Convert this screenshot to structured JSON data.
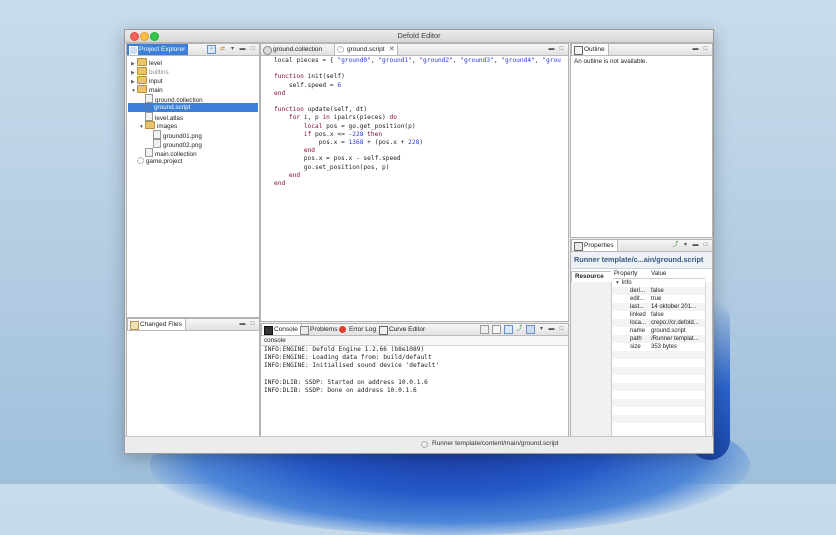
{
  "window": {
    "title": "Defold Editor"
  },
  "project_explorer": {
    "tab_label": "Project Explorer",
    "items": [
      {
        "label": "level",
        "kind": "folder",
        "indent": 0,
        "arrow": "▶"
      },
      {
        "label": "builtins",
        "kind": "folder",
        "indent": 0,
        "arrow": "▶"
      },
      {
        "label": "input",
        "kind": "folder",
        "indent": 0,
        "arrow": "▶"
      },
      {
        "label": "main",
        "kind": "folder",
        "indent": 0,
        "arrow": "▼"
      },
      {
        "label": "ground.collection",
        "kind": "file",
        "indent": 1,
        "arrow": ""
      },
      {
        "label": "ground.script",
        "kind": "script",
        "indent": 1,
        "arrow": "",
        "selected": true
      },
      {
        "label": "level.atlas",
        "kind": "file",
        "indent": 1,
        "arrow": ""
      },
      {
        "label": "images",
        "kind": "folder",
        "indent": 1,
        "arrow": "▼"
      },
      {
        "label": "ground01.png",
        "kind": "file",
        "indent": 2,
        "arrow": ""
      },
      {
        "label": "ground02.png",
        "kind": "file",
        "indent": 2,
        "arrow": ""
      },
      {
        "label": "main.collection",
        "kind": "file",
        "indent": 1,
        "arrow": ""
      },
      {
        "label": "game.project",
        "kind": "script",
        "indent": 0,
        "arrow": ""
      }
    ]
  },
  "changed_files": {
    "tab_label": "Changed Files"
  },
  "editor": {
    "tabs": [
      {
        "label": "ground.collection"
      },
      {
        "label": "ground.script"
      }
    ],
    "code": [
      [
        [
          "t",
          "local pieces = { "
        ],
        [
          "s",
          "\"ground0\""
        ],
        [
          "t",
          ", "
        ],
        [
          "s",
          "\"ground1\""
        ],
        [
          "t",
          ", "
        ],
        [
          "s",
          "\"ground2\""
        ],
        [
          "t",
          ", "
        ],
        [
          "s",
          "\"ground3\""
        ],
        [
          "t",
          ", "
        ],
        [
          "s",
          "\"ground4\""
        ],
        [
          "t",
          ", "
        ],
        [
          "s",
          "\"grou"
        ]
      ],
      [],
      [
        [
          "k",
          "function"
        ],
        [
          "t",
          " init(self)"
        ]
      ],
      [
        [
          "t",
          "    self.speed = "
        ],
        [
          "n",
          "6"
        ]
      ],
      [
        [
          "k",
          "end"
        ]
      ],
      [],
      [
        [
          "k",
          "function"
        ],
        [
          "t",
          " update(self, dt)"
        ]
      ],
      [
        [
          "t",
          "    "
        ],
        [
          "k",
          "for"
        ],
        [
          "t",
          " i, p "
        ],
        [
          "k",
          "in"
        ],
        [
          "t",
          " ipairs(pieces) "
        ],
        [
          "k",
          "do"
        ]
      ],
      [
        [
          "t",
          "        "
        ],
        [
          "k",
          "local"
        ],
        [
          "t",
          " pos = go.get_position(p)"
        ]
      ],
      [
        [
          "t",
          "        "
        ],
        [
          "k",
          "if"
        ],
        [
          "t",
          " pos.x <= "
        ],
        [
          "n",
          "-228"
        ],
        [
          "t",
          " "
        ],
        [
          "k",
          "then"
        ]
      ],
      [
        [
          "t",
          "            pos.x = "
        ],
        [
          "n",
          "1368"
        ],
        [
          "t",
          " + (pos.x + "
        ],
        [
          "n",
          "228"
        ],
        [
          "t",
          ")"
        ]
      ],
      [
        [
          "t",
          "        "
        ],
        [
          "k",
          "end"
        ]
      ],
      [
        [
          "t",
          "        pos.x = pos.x - self.speed"
        ]
      ],
      [
        [
          "t",
          "        go.set_position(pos, p)"
        ]
      ],
      [
        [
          "t",
          "    "
        ],
        [
          "k",
          "end"
        ]
      ],
      [
        [
          "k",
          "end"
        ]
      ]
    ]
  },
  "outline": {
    "tab_label": "Outline",
    "message": "An outline is not available."
  },
  "properties": {
    "tab_label": "Properties",
    "header": "Runner template/c...ain/ground.script",
    "section_tab": "Resource",
    "col_property": "Property",
    "col_value": "Value",
    "group": "Info",
    "rows": [
      {
        "name": "deri...",
        "value": "false"
      },
      {
        "name": "edit...",
        "value": "true"
      },
      {
        "name": "last...",
        "value": "14 oktober 201..."
      },
      {
        "name": "linked",
        "value": "false"
      },
      {
        "name": "loca...",
        "value": "crepo://cr.defold..."
      },
      {
        "name": "name",
        "value": "ground.script"
      },
      {
        "name": "path",
        "value": "/Runner templat..."
      },
      {
        "name": "size",
        "value": "353  bytes"
      }
    ]
  },
  "console": {
    "tabs": [
      {
        "label": "Console"
      },
      {
        "label": "Problems"
      },
      {
        "label": "Error Log"
      },
      {
        "label": "Curve Editor"
      }
    ],
    "subheader": "console",
    "lines": [
      "INFO:ENGINE: Defold Engine 1.2.66 (b8e1089)",
      "INFO:ENGINE: Loading data from: build/default",
      "INFO:ENGINE: Initialised sound device 'default'",
      "",
      "INFO:DLIB: SSDP: Started on address 10.0.1.6",
      "INFO:DLIB: SSDP: Done on address 10.0.1.6"
    ]
  },
  "status": {
    "path": "Runner template/content/main/ground.script"
  }
}
